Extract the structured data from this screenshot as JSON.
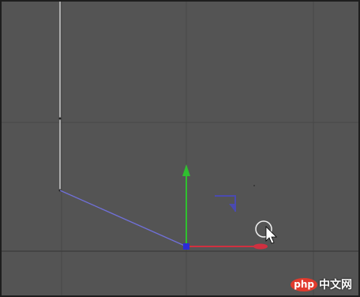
{
  "viewport": {
    "name": "3D viewport",
    "background_color": "#545454",
    "grid_color": "#474747",
    "grid_axis_color": "#3a3a3a"
  },
  "spline": {
    "color_top": "#c8c8c8",
    "color_bottom": "#7070d8"
  },
  "gizmo": {
    "x_axis_color": "#d03040",
    "y_axis_color": "#2fc02f",
    "z_axis_color": "#3030c8",
    "pivot_color": "#2b2bd8"
  },
  "icons": {
    "rotation_indicator": "rotation-corner-icon",
    "cursor": "mouse-pointer-icon",
    "cursor_ring": "selection-circle-icon"
  },
  "watermark": {
    "logo": "php",
    "text": "中文网"
  }
}
